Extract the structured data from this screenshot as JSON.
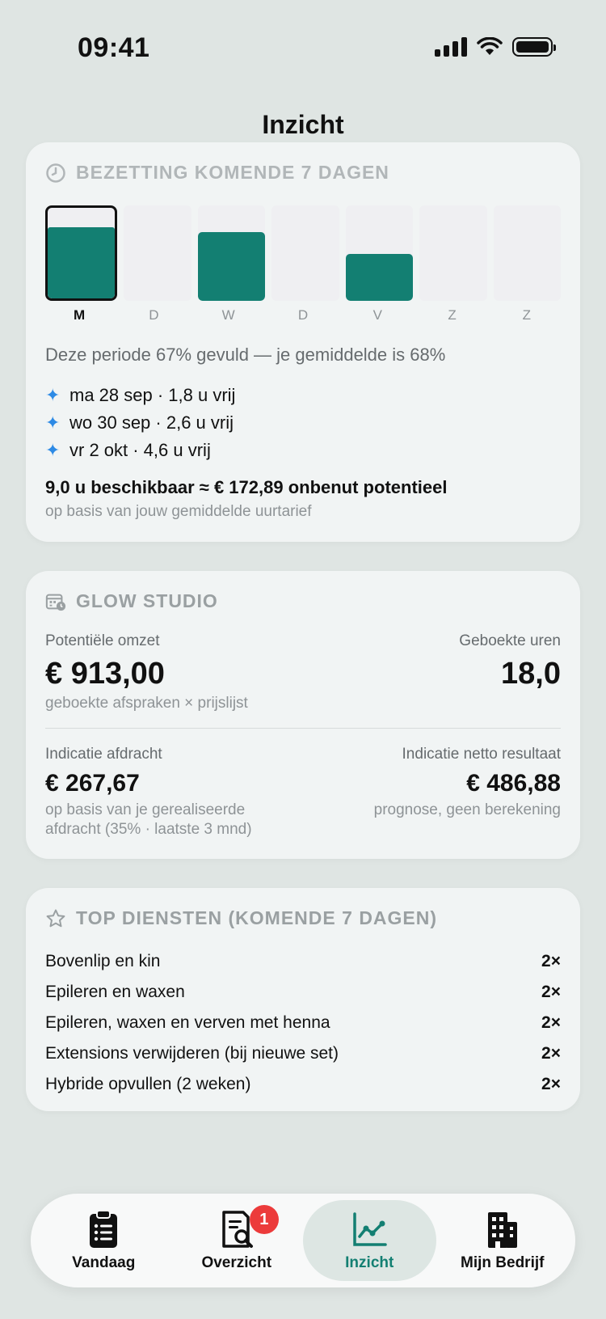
{
  "status_bar": {
    "time": "09:41"
  },
  "nav": {
    "title": "Inzicht"
  },
  "occupancy": {
    "header": "BEZETTING KOMENDE 7 DAGEN",
    "days": [
      {
        "label": "M",
        "fill": 0.79,
        "selected": true
      },
      {
        "label": "D",
        "fill": 0,
        "selected": false
      },
      {
        "label": "W",
        "fill": 0.72,
        "selected": false
      },
      {
        "label": "D",
        "fill": 0,
        "selected": false
      },
      {
        "label": "V",
        "fill": 0.49,
        "selected": false
      },
      {
        "label": "Z",
        "fill": 0,
        "selected": false
      },
      {
        "label": "Z",
        "fill": 0,
        "selected": false
      }
    ],
    "period_text": "Deze periode 67% gevuld — je gemiddelde is 68%",
    "free_slots": [
      "ma 28 sep · 1,8 u vrij",
      "wo 30 sep · 2,6 u vrij",
      "vr 2 okt · 4,6 u vrij"
    ],
    "available_text": "9,0 u beschikbaar ≈ € 172,89 onbenut potentieel",
    "available_sub": "op basis van jouw gemiddelde uurtarief"
  },
  "studio": {
    "header": "GLOW STUDIO",
    "potential_label": "Potentiële omzet",
    "potential_value": "€ 913,00",
    "potential_sub": "geboekte afspraken × prijslijst",
    "hours_label": "Geboekte uren",
    "hours_value": "18,0",
    "payout_label": "Indicatie afdracht",
    "payout_value": "€ 267,67",
    "payout_sub_1": "op basis van je gerealiseerde",
    "payout_sub_2": "afdracht (35% · laatste 3 mnd)",
    "net_label": "Indicatie netto resultaat",
    "net_value": "€ 486,88",
    "net_sub": "prognose, geen berekening"
  },
  "top_services": {
    "header": "TOP DIENSTEN (KOMENDE 7 DAGEN)",
    "items": [
      {
        "name": "Bovenlip en kin",
        "count": "2×"
      },
      {
        "name": "Epileren en waxen",
        "count": "2×"
      },
      {
        "name": "Epileren, waxen en verven met henna",
        "count": "2×"
      },
      {
        "name": "Extensions verwijderen (bij nieuwe set)",
        "count": "2×"
      },
      {
        "name": "Hybride opvullen (2 weken)",
        "count": "2×"
      }
    ]
  },
  "tabbar": {
    "tabs": [
      {
        "label": "Vandaag",
        "icon": "clipboard-list-icon"
      },
      {
        "label": "Overzicht",
        "icon": "document-search-icon",
        "badge": "1"
      },
      {
        "label": "Inzicht",
        "icon": "chart-line-icon",
        "active": true
      },
      {
        "label": "Mijn Bedrijf",
        "icon": "building-icon"
      }
    ]
  },
  "colors": {
    "accent": "#137f72",
    "badge": "#ec3b3b",
    "sparkle": "#2d8ae5"
  }
}
